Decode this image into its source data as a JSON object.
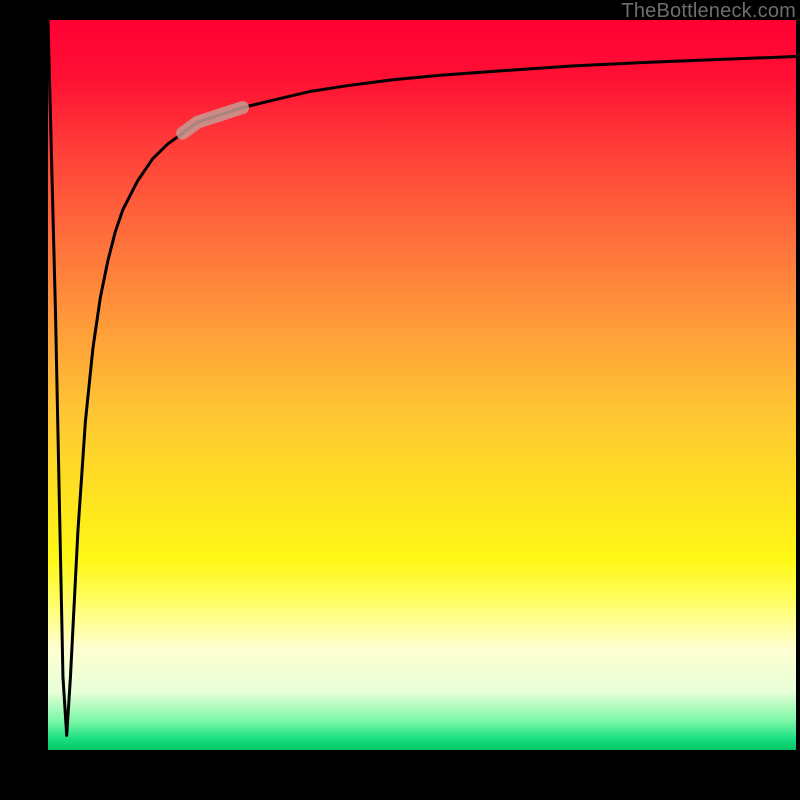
{
  "watermark": {
    "text": "TheBottleneck.com"
  },
  "colors": {
    "background": "#000000",
    "curve": "#000000",
    "highlight": "#c59b93",
    "gradient_top": "#ff0033",
    "gradient_mid": "#ffe41f",
    "gradient_bottom": "#03c565"
  },
  "chart_data": {
    "type": "line",
    "title": "",
    "xlabel": "",
    "ylabel": "",
    "xlim": [
      0,
      100
    ],
    "ylim": [
      0,
      100
    ],
    "grid": false,
    "series": [
      {
        "name": "bottleneck-curve",
        "x": [
          0,
          1,
          2,
          2.5,
          3,
          4,
          5,
          6,
          7,
          8,
          9,
          10,
          12,
          14,
          16,
          18,
          20,
          23,
          26,
          30,
          35,
          40,
          46,
          52,
          60,
          70,
          80,
          90,
          100
        ],
        "values": [
          100,
          60,
          10,
          2,
          10,
          30,
          45,
          55,
          62,
          67,
          71,
          74,
          78,
          81,
          83,
          84.5,
          86,
          87,
          88,
          89,
          90.2,
          91,
          91.8,
          92.4,
          93,
          93.7,
          94.2,
          94.6,
          95
        ]
      },
      {
        "name": "highlight-segment",
        "x": [
          18,
          20,
          23,
          26
        ],
        "values": [
          84.5,
          86,
          87,
          88
        ]
      }
    ],
    "annotations": []
  }
}
